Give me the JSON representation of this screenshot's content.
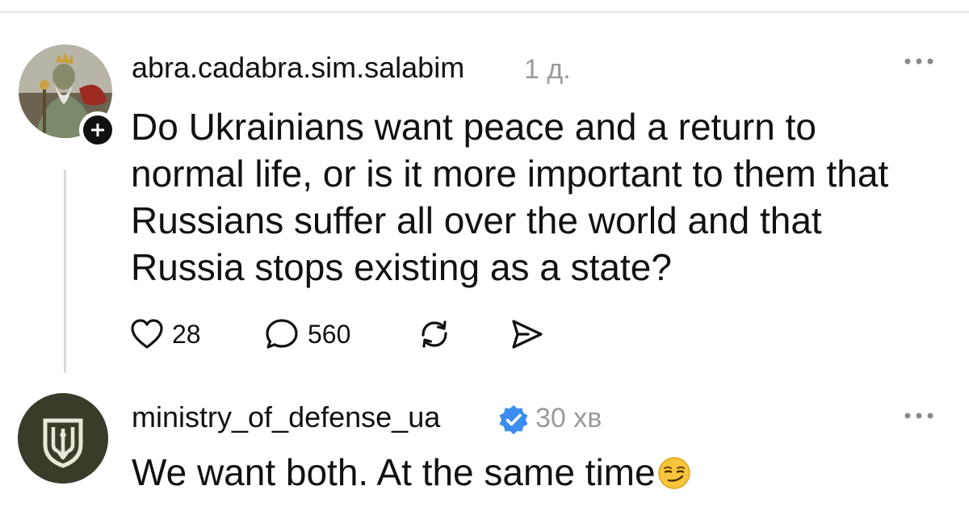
{
  "post": {
    "username": "abra.cadabra.sim.salabim",
    "time": "1 д.",
    "text": "Do Ukrainians want peace and a return to normal life, or is it more important to them that Russians suffer all over the world and that Russia stops existing as a state?",
    "likes": "28",
    "comments": "560",
    "icons": {
      "more": "more-horizontal-icon",
      "follow": "plus-icon",
      "like": "heart-icon",
      "comment": "speech-bubble-icon",
      "repost": "repost-icon",
      "share": "send-icon"
    }
  },
  "reply": {
    "username": "ministry_of_defense_ua",
    "time": "30 хв",
    "text": "We want both. At the same time",
    "emoji": "smirking-face-icon",
    "verified_icon": "verified-badge-icon"
  },
  "colors": {
    "text": "#111111",
    "muted": "#9a9a9a",
    "verified": "#3c8df0",
    "divider": "#e6e6e6"
  }
}
